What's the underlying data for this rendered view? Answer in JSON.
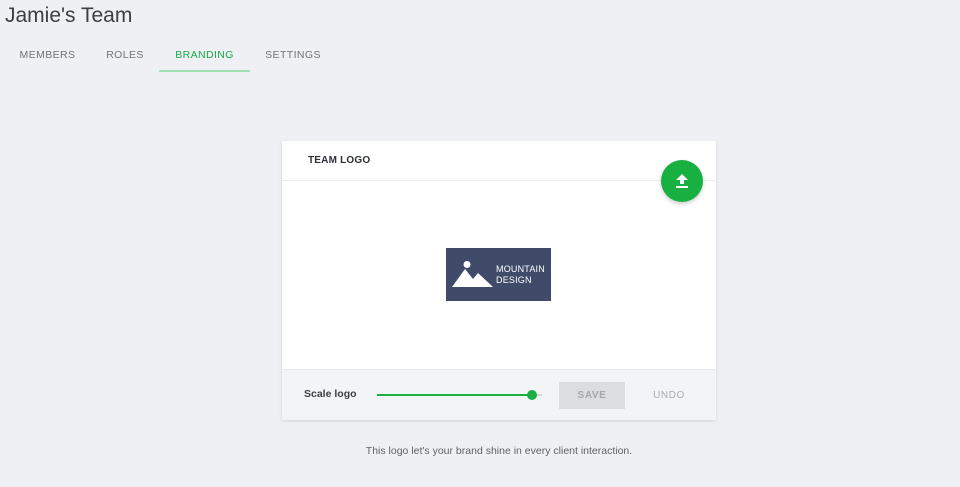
{
  "page": {
    "title": "Jamie's Team"
  },
  "tabs": [
    {
      "label": "MEMBERS",
      "active": false
    },
    {
      "label": "ROLES",
      "active": false
    },
    {
      "label": "BRANDING",
      "active": true
    },
    {
      "label": "SETTINGS",
      "active": false
    }
  ],
  "card": {
    "header": "TEAM LOGO",
    "upload_icon": "upload-arrow-icon",
    "logo": {
      "line1": "MOUNTAIN",
      "line2": "DESIGN",
      "icon": "mountain-sun-icon",
      "background": "#3f4b69"
    },
    "footer": {
      "scale_label": "Scale logo",
      "scale_value": 0.94,
      "save_label": "SAVE",
      "undo_label": "UNDO"
    }
  },
  "helper_text": "This logo let's your brand shine in every client interaction.",
  "colors": {
    "accent": "#17b041",
    "active_tab": "#19a84a",
    "background": "#eef0f3"
  }
}
